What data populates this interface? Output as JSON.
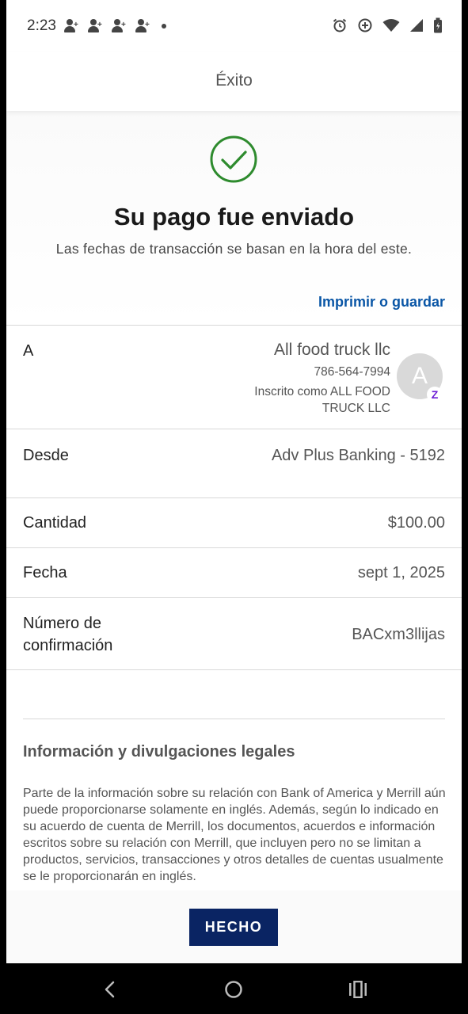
{
  "status_bar": {
    "time": "2:23"
  },
  "header": {
    "title": "Éxito"
  },
  "success": {
    "title": "Su pago fue enviado",
    "subtitle": "Las fechas de transacción se basan en la hora del este.",
    "print_link": "Imprimir o guardar"
  },
  "details": {
    "to": {
      "label": "A",
      "name": "All food truck llc",
      "phone": "786-564-7994",
      "enrolled": "Inscrito como ALL FOOD TRUCK LLC",
      "avatar_letter": "A",
      "badge": "Z"
    },
    "from": {
      "label": "Desde",
      "value": "Adv Plus Banking - 5192"
    },
    "amount": {
      "label": "Cantidad",
      "value": "$100.00"
    },
    "date": {
      "label": "Fecha",
      "value": "sept 1, 2025"
    },
    "confirmation": {
      "label": "Número de confirmación",
      "value": "BACxm3llijas"
    }
  },
  "legal": {
    "title": "Información y divulgaciones legales",
    "body": "Parte de la información sobre su relación con Bank of America y Merrill aún puede proporcionarse solamente en inglés. Además, según lo indicado en su acuerdo de cuenta de Merrill, los documentos, acuerdos e información escritos sobre su relación con Merrill, que incluyen pero no se limitan a productos, servicios, transacciones y otros detalles de cuentas usualmente se le proporcionarán en inglés."
  },
  "footer": {
    "done_label": "HECHO"
  },
  "colors": {
    "link": "#0a56a6",
    "primary_button": "#0a2463",
    "success_check": "#2e8b2e",
    "zelle": "#6d1ed4"
  }
}
